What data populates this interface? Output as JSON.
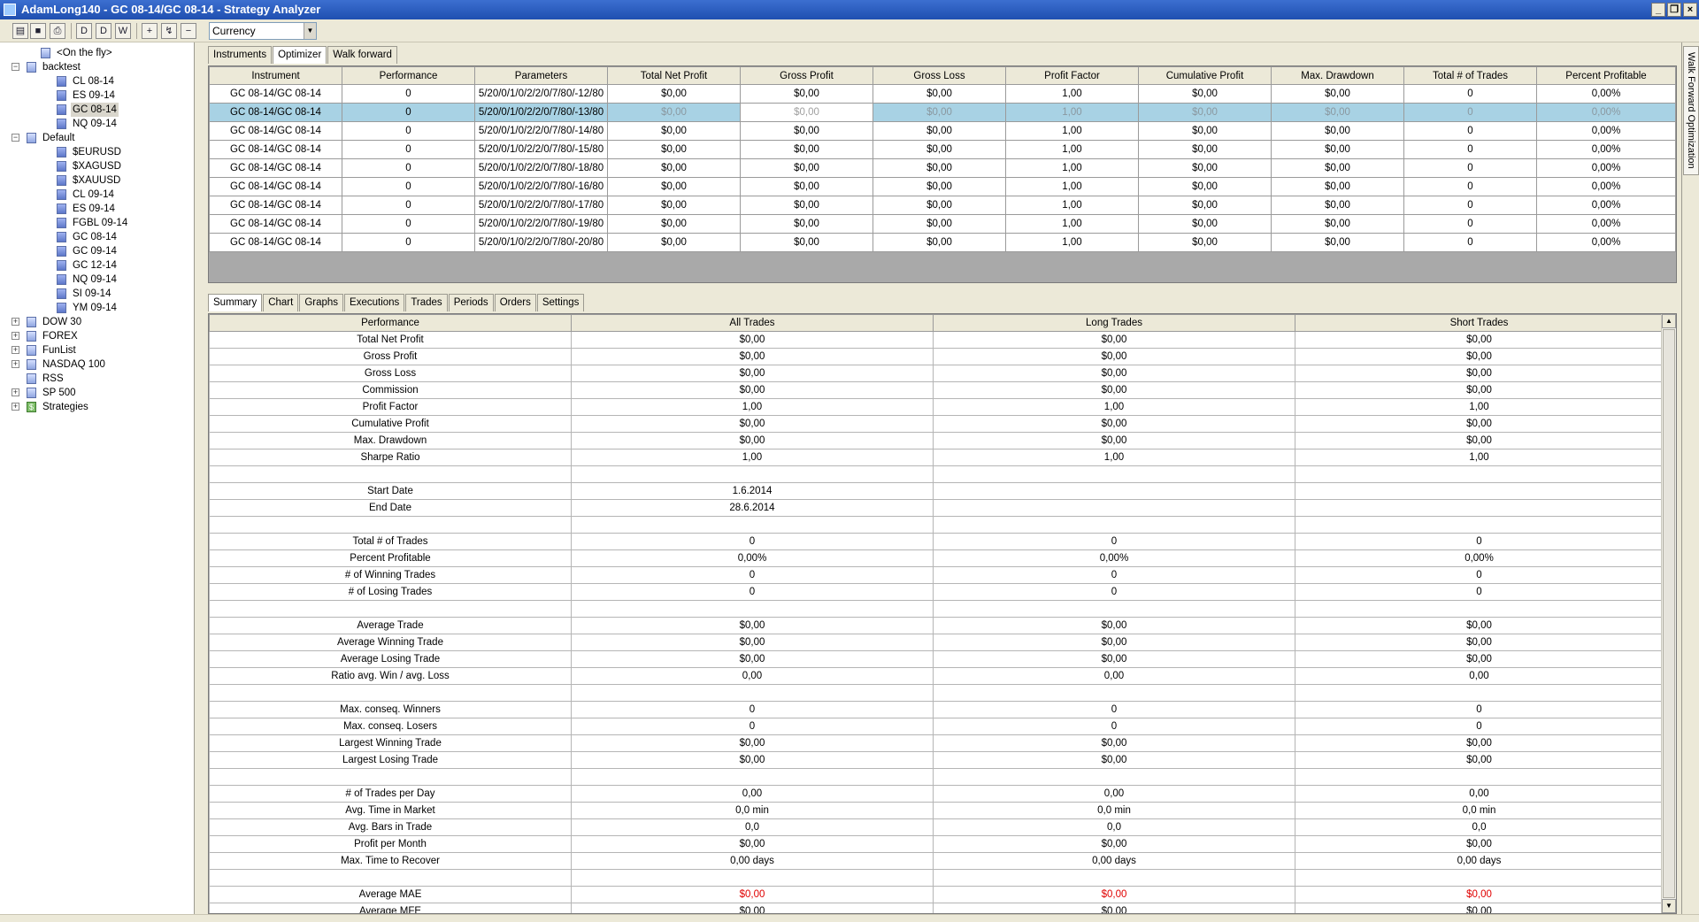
{
  "window": {
    "title": "AdamLong140 - GC 08-14/GC 08-14 - Strategy Analyzer"
  },
  "toolbar": {
    "display_unit": "Currency"
  },
  "tree": {
    "items": [
      {
        "label": "<On the fly>",
        "level": 1,
        "expander": "",
        "icon": "list"
      },
      {
        "label": "backtest",
        "level": 0,
        "expander": "−",
        "icon": "list"
      },
      {
        "label": "CL 08-14",
        "level": 2,
        "expander": "",
        "icon": "inst"
      },
      {
        "label": "ES 09-14",
        "level": 2,
        "expander": "",
        "icon": "inst"
      },
      {
        "label": "GC 08-14",
        "level": 2,
        "expander": "",
        "icon": "inst",
        "selected": true
      },
      {
        "label": "NQ 09-14",
        "level": 2,
        "expander": "",
        "icon": "inst"
      },
      {
        "label": "Default",
        "level": 0,
        "expander": "−",
        "icon": "list"
      },
      {
        "label": "$EURUSD",
        "level": 2,
        "expander": "",
        "icon": "inst"
      },
      {
        "label": "$XAGUSD",
        "level": 2,
        "expander": "",
        "icon": "inst"
      },
      {
        "label": "$XAUUSD",
        "level": 2,
        "expander": "",
        "icon": "inst"
      },
      {
        "label": "CL 09-14",
        "level": 2,
        "expander": "",
        "icon": "inst"
      },
      {
        "label": "ES 09-14",
        "level": 2,
        "expander": "",
        "icon": "inst"
      },
      {
        "label": "FGBL 09-14",
        "level": 2,
        "expander": "",
        "icon": "inst"
      },
      {
        "label": "GC 08-14",
        "level": 2,
        "expander": "",
        "icon": "inst"
      },
      {
        "label": "GC 09-14",
        "level": 2,
        "expander": "",
        "icon": "inst"
      },
      {
        "label": "GC 12-14",
        "level": 2,
        "expander": "",
        "icon": "inst"
      },
      {
        "label": "NQ 09-14",
        "level": 2,
        "expander": "",
        "icon": "inst"
      },
      {
        "label": "SI 09-14",
        "level": 2,
        "expander": "",
        "icon": "inst"
      },
      {
        "label": "YM 09-14",
        "level": 2,
        "expander": "",
        "icon": "inst"
      },
      {
        "label": "DOW 30",
        "level": 0,
        "expander": "+",
        "icon": "list"
      },
      {
        "label": "FOREX",
        "level": 0,
        "expander": "+",
        "icon": "list"
      },
      {
        "label": "FunList",
        "level": 0,
        "expander": "+",
        "icon": "list"
      },
      {
        "label": "NASDAQ 100",
        "level": 0,
        "expander": "+",
        "icon": "list"
      },
      {
        "label": "RSS",
        "level": 0,
        "expander": "",
        "icon": "list"
      },
      {
        "label": "SP 500",
        "level": 0,
        "expander": "+",
        "icon": "list"
      },
      {
        "label": "Strategies",
        "level": 0,
        "expander": "+",
        "icon": "strat"
      }
    ]
  },
  "top_tabs": [
    "Instruments",
    "Optimizer",
    "Walk forward"
  ],
  "optimizer": {
    "columns": [
      "Instrument",
      "Performance",
      "Parameters",
      "Total Net Profit",
      "Gross Profit",
      "Gross Loss",
      "Profit Factor",
      "Cumulative Profit",
      "Max. Drawdown",
      "Total # of Trades",
      "Percent Profitable"
    ],
    "rows": [
      [
        "GC 08-14/GC 08-14",
        "0",
        "5/20/0/1/0/2/2/0/7/80/-12/80",
        "$0,00",
        "$0,00",
        "$0,00",
        "1,00",
        "$0,00",
        "$0,00",
        "0",
        "0,00%"
      ],
      [
        "GC 08-14/GC 08-14",
        "0",
        "5/20/0/1/0/2/2/0/7/80/-13/80",
        "$0,00",
        "$0,00",
        "$0,00",
        "1,00",
        "$0,00",
        "$0,00",
        "0",
        "0,00%"
      ],
      [
        "GC 08-14/GC 08-14",
        "0",
        "5/20/0/1/0/2/2/0/7/80/-14/80",
        "$0,00",
        "$0,00",
        "$0,00",
        "1,00",
        "$0,00",
        "$0,00",
        "0",
        "0,00%"
      ],
      [
        "GC 08-14/GC 08-14",
        "0",
        "5/20/0/1/0/2/2/0/7/80/-15/80",
        "$0,00",
        "$0,00",
        "$0,00",
        "1,00",
        "$0,00",
        "$0,00",
        "0",
        "0,00%"
      ],
      [
        "GC 08-14/GC 08-14",
        "0",
        "5/20/0/1/0/2/2/0/7/80/-18/80",
        "$0,00",
        "$0,00",
        "$0,00",
        "1,00",
        "$0,00",
        "$0,00",
        "0",
        "0,00%"
      ],
      [
        "GC 08-14/GC 08-14",
        "0",
        "5/20/0/1/0/2/2/0/7/80/-16/80",
        "$0,00",
        "$0,00",
        "$0,00",
        "1,00",
        "$0,00",
        "$0,00",
        "0",
        "0,00%"
      ],
      [
        "GC 08-14/GC 08-14",
        "0",
        "5/20/0/1/0/2/2/0/7/80/-17/80",
        "$0,00",
        "$0,00",
        "$0,00",
        "1,00",
        "$0,00",
        "$0,00",
        "0",
        "0,00%"
      ],
      [
        "GC 08-14/GC 08-14",
        "0",
        "5/20/0/1/0/2/2/0/7/80/-19/80",
        "$0,00",
        "$0,00",
        "$0,00",
        "1,00",
        "$0,00",
        "$0,00",
        "0",
        "0,00%"
      ],
      [
        "GC 08-14/GC 08-14",
        "0",
        "5/20/0/1/0/2/2/0/7/80/-20/80",
        "$0,00",
        "$0,00",
        "$0,00",
        "1,00",
        "$0,00",
        "$0,00",
        "0",
        "0,00%"
      ]
    ],
    "selected_row": 1
  },
  "bottom_tabs": [
    "Summary",
    "Chart",
    "Graphs",
    "Executions",
    "Trades",
    "Periods",
    "Orders",
    "Settings"
  ],
  "summary": {
    "columns": [
      "Performance",
      "All Trades",
      "Long Trades",
      "Short Trades"
    ],
    "negative_color": "#e00000",
    "rows": [
      [
        "Total Net Profit",
        "$0,00",
        "$0,00",
        "$0,00"
      ],
      [
        "Gross Profit",
        "$0,00",
        "$0,00",
        "$0,00"
      ],
      [
        "Gross Loss",
        "$0,00",
        "$0,00",
        "$0,00"
      ],
      [
        "Commission",
        "$0,00",
        "$0,00",
        "$0,00"
      ],
      [
        "Profit Factor",
        "1,00",
        "1,00",
        "1,00"
      ],
      [
        "Cumulative Profit",
        "$0,00",
        "$0,00",
        "$0,00"
      ],
      [
        "Max. Drawdown",
        "$0,00",
        "$0,00",
        "$0,00"
      ],
      [
        "Sharpe Ratio",
        "1,00",
        "1,00",
        "1,00"
      ],
      [
        "",
        "",
        "",
        ""
      ],
      [
        "Start Date",
        "1.6.2014",
        "",
        ""
      ],
      [
        "End Date",
        "28.6.2014",
        "",
        ""
      ],
      [
        "",
        "",
        "",
        ""
      ],
      [
        "Total # of Trades",
        "0",
        "0",
        "0"
      ],
      [
        "Percent Profitable",
        "0,00%",
        "0,00%",
        "0,00%"
      ],
      [
        "# of Winning Trades",
        "0",
        "0",
        "0"
      ],
      [
        "# of Losing Trades",
        "0",
        "0",
        "0"
      ],
      [
        "",
        "",
        "",
        ""
      ],
      [
        "Average Trade",
        "$0,00",
        "$0,00",
        "$0,00"
      ],
      [
        "Average Winning Trade",
        "$0,00",
        "$0,00",
        "$0,00"
      ],
      [
        "Average Losing Trade",
        "$0,00",
        "$0,00",
        "$0,00"
      ],
      [
        "Ratio avg. Win / avg. Loss",
        "0,00",
        "0,00",
        "0,00"
      ],
      [
        "",
        "",
        "",
        ""
      ],
      [
        "Max. conseq. Winners",
        "0",
        "0",
        "0"
      ],
      [
        "Max. conseq. Losers",
        "0",
        "0",
        "0"
      ],
      [
        "Largest Winning Trade",
        "$0,00",
        "$0,00",
        "$0,00"
      ],
      [
        "Largest Losing Trade",
        "$0,00",
        "$0,00",
        "$0,00"
      ],
      [
        "",
        "",
        "",
        ""
      ],
      [
        "# of Trades per Day",
        "0,00",
        "0,00",
        "0,00"
      ],
      [
        "Avg. Time in Market",
        "0,0 min",
        "0,0 min",
        "0,0 min"
      ],
      [
        "Avg. Bars in Trade",
        "0,0",
        "0,0",
        "0,0"
      ],
      [
        "Profit per Month",
        "$0,00",
        "$0,00",
        "$0,00"
      ],
      [
        "Max. Time to Recover",
        "0,00 days",
        "0,00 days",
        "0,00 days"
      ],
      [
        "",
        "",
        "",
        ""
      ],
      [
        "Average MAE",
        "$0,00",
        "$0,00",
        "$0,00"
      ],
      [
        "Average MFE",
        "$0,00",
        "$0,00",
        "$0,00"
      ]
    ],
    "negative_rows": [
      33
    ]
  },
  "side_panel": {
    "label": "Walk Forward Optimization"
  }
}
